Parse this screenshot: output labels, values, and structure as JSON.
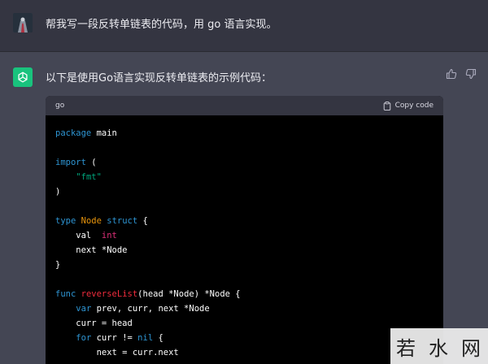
{
  "user_message": {
    "text": "帮我写一段反转单链表的代码，用 go 语言实现。"
  },
  "assistant_message": {
    "intro": "以下是使用Go语言实现反转单链表的示例代码：",
    "feedback": {
      "thumbs_up": "thumbs-up-icon",
      "thumbs_down": "thumbs-down-icon"
    },
    "code_block": {
      "language": "go",
      "copy_label": "Copy code",
      "lines": [
        [
          {
            "t": "package",
            "c": "kw"
          },
          {
            "t": " main"
          }
        ],
        [],
        [
          {
            "t": "import",
            "c": "kw"
          },
          {
            "t": " ("
          }
        ],
        [
          {
            "t": "    "
          },
          {
            "t": "\"fmt\"",
            "c": "str"
          }
        ],
        [
          {
            "t": ")"
          }
        ],
        [],
        [
          {
            "t": "type",
            "c": "kw"
          },
          {
            "t": " "
          },
          {
            "t": "Node",
            "c": "ty"
          },
          {
            "t": " "
          },
          {
            "t": "struct",
            "c": "kw"
          },
          {
            "t": " {"
          }
        ],
        [
          {
            "t": "    val  "
          },
          {
            "t": "int",
            "c": "red"
          }
        ],
        [
          {
            "t": "    next *Node"
          }
        ],
        [
          {
            "t": "}"
          }
        ],
        [],
        [
          {
            "t": "func",
            "c": "kw"
          },
          {
            "t": " "
          },
          {
            "t": "reverseList",
            "c": "fn"
          },
          {
            "t": "(head *Node) *Node {"
          }
        ],
        [
          {
            "t": "    "
          },
          {
            "t": "var",
            "c": "kw"
          },
          {
            "t": " prev, curr, next *Node"
          }
        ],
        [
          {
            "t": "    curr = head"
          }
        ],
        [
          {
            "t": "    "
          },
          {
            "t": "for",
            "c": "kw"
          },
          {
            "t": " curr != "
          },
          {
            "t": "nil",
            "c": "kw"
          },
          {
            "t": " {"
          }
        ],
        [
          {
            "t": "        next = curr.next"
          }
        ]
      ]
    }
  },
  "watermark": {
    "chars": [
      "若",
      "水",
      "网"
    ]
  },
  "colors": {
    "user_bg": "#343541",
    "assistant_bg": "#444654",
    "accent": "#19c37d",
    "code_bg": "#000000"
  }
}
